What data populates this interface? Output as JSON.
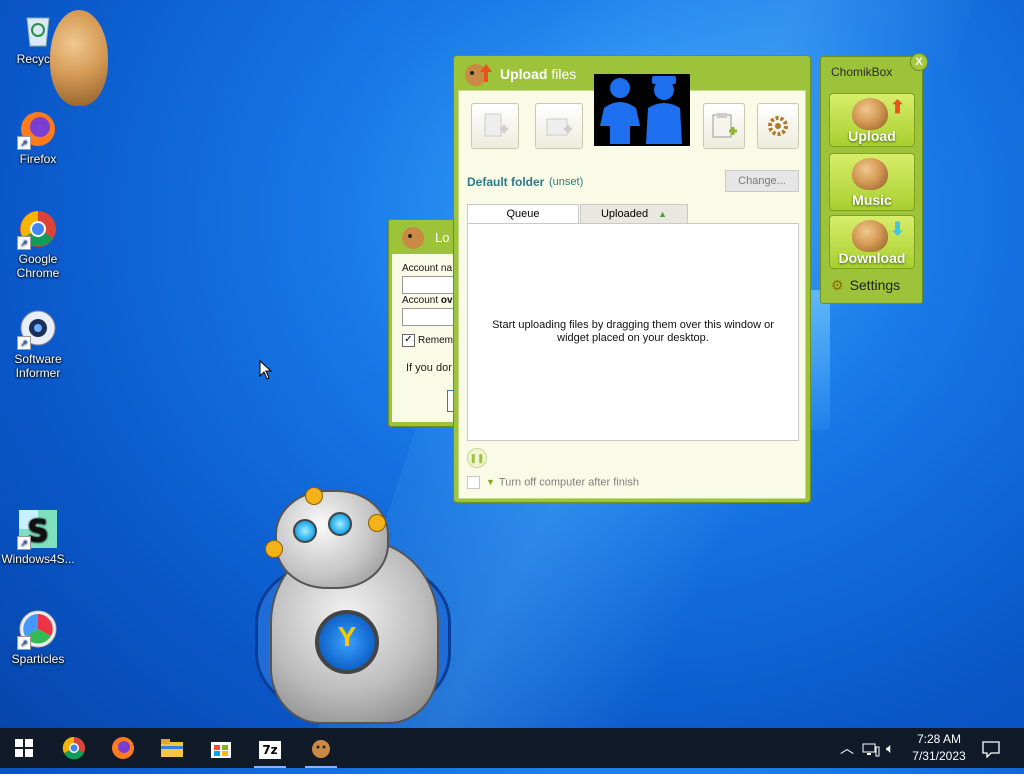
{
  "desktop": {
    "icons": [
      {
        "label": "Recycle",
        "icon": "recycle-bin-icon"
      },
      {
        "label": "Firefox",
        "icon": "firefox-icon"
      },
      {
        "label": "Google Chrome",
        "icon": "chrome-icon"
      },
      {
        "label": "Software Informer",
        "icon": "software-informer-icon"
      },
      {
        "label": "Windows4S...",
        "icon": "windows4s-icon"
      },
      {
        "label": "Sparticles",
        "icon": "sparticles-icon"
      }
    ]
  },
  "upload_window": {
    "title_bold": "Upload",
    "title_rest": "files",
    "default_folder_label": "Default folder",
    "default_folder_value": "(unset)",
    "change_button": "Change...",
    "tabs": {
      "queue": "Queue",
      "uploaded": "Uploaded"
    },
    "empty_message": "Start uploading files by dragging them over this window or widget placed on your desktop.",
    "turn_off_label": "Turn off computer after finish"
  },
  "login_window": {
    "title": "Lo",
    "account_name_label": "Account na",
    "account_password_label_a": "Account ",
    "account_password_label_b": "ov",
    "remember_label": "Rememl",
    "note": "If you dor"
  },
  "widget": {
    "title": "ChomikBox",
    "close": "X",
    "upload": "Upload",
    "music": "Music",
    "download": "Download",
    "settings": "Settings"
  },
  "taskbar": {
    "time": "7:28 AM",
    "date": "7/31/2023",
    "sevenzip": "7z"
  },
  "colors": {
    "accent_green": "#9dc33a",
    "desktop_blue": "#1777e6",
    "taskbar": "#101a28"
  }
}
